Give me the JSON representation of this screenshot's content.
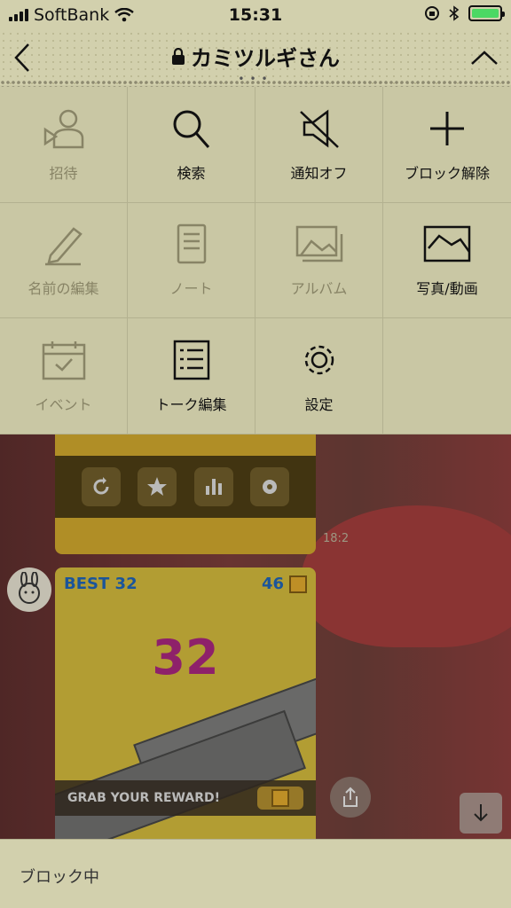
{
  "status_bar": {
    "carrier": "SoftBank",
    "time": "15:31"
  },
  "header": {
    "title": "カミツルギさん"
  },
  "menu": {
    "items": [
      {
        "label": "招待",
        "icon": "invite-user-icon",
        "enabled": false
      },
      {
        "label": "検索",
        "icon": "search-icon",
        "enabled": true
      },
      {
        "label": "通知オフ",
        "icon": "mute-notification-icon",
        "enabled": true
      },
      {
        "label": "ブロック解除",
        "icon": "plus-icon",
        "enabled": true
      },
      {
        "label": "名前の編集",
        "icon": "pencil-icon",
        "enabled": false
      },
      {
        "label": "ノート",
        "icon": "note-icon",
        "enabled": false
      },
      {
        "label": "アルバム",
        "icon": "album-icon",
        "enabled": false
      },
      {
        "label": "写真/動画",
        "icon": "photo-icon",
        "enabled": true
      },
      {
        "label": "イベント",
        "icon": "calendar-icon",
        "enabled": false
      },
      {
        "label": "トーク編集",
        "icon": "checklist-icon",
        "enabled": true
      },
      {
        "label": "設定",
        "icon": "gear-icon",
        "enabled": true
      }
    ]
  },
  "chat": {
    "timestamp": "18:2",
    "game": {
      "best_label": "BEST",
      "best_value": "32",
      "coins": "46",
      "score": "32",
      "reward": "GRAB YOUR REWARD!"
    }
  },
  "footer": {
    "status": "ブロック中"
  },
  "colors": {
    "background": "#c9c7a4",
    "disabled_text": "#888466",
    "score": "#a8237d",
    "best": "#1c62b7"
  }
}
